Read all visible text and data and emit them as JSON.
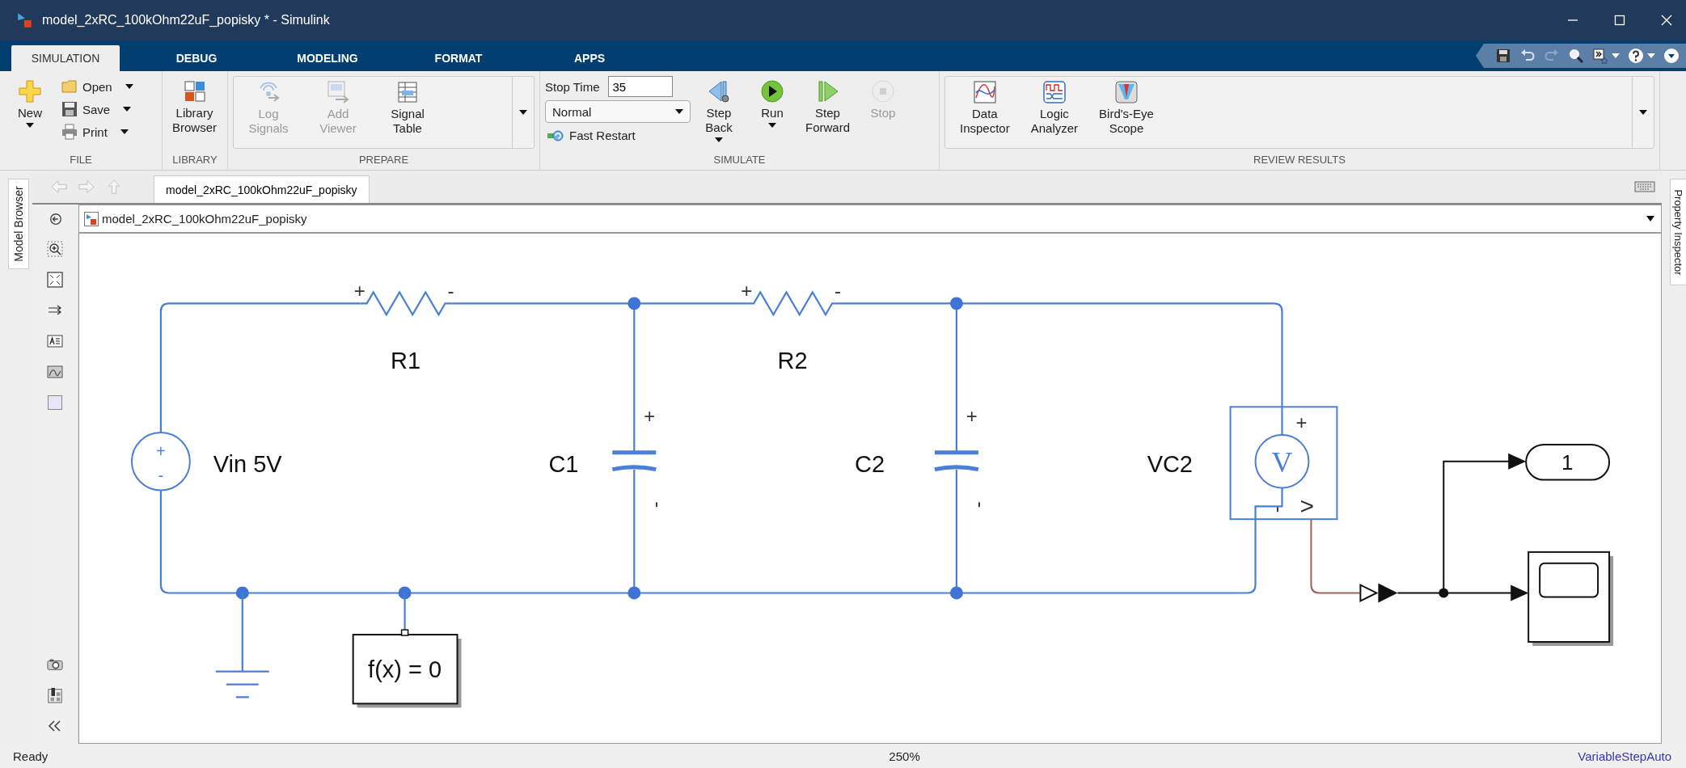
{
  "window": {
    "title": "model_2xRC_100kOhm22uF_popisky * - Simulink"
  },
  "tabs": [
    {
      "label": "SIMULATION",
      "selected": true
    },
    {
      "label": "DEBUG",
      "selected": false
    },
    {
      "label": "MODELING",
      "selected": false
    },
    {
      "label": "FORMAT",
      "selected": false
    },
    {
      "label": "APPS",
      "selected": false
    }
  ],
  "ribbon": {
    "file": {
      "title": "FILE",
      "new": "New",
      "open": "Open",
      "save": "Save",
      "print": "Print"
    },
    "library": {
      "title": "LIBRARY",
      "browser": "Library\nBrowser"
    },
    "prepare": {
      "title": "PREPARE",
      "buttons": [
        {
          "label": "Log\nSignals",
          "disabled": true
        },
        {
          "label": "Add\nViewer",
          "disabled": true
        },
        {
          "label": "Signal\nTable",
          "disabled": false
        }
      ]
    },
    "simulate": {
      "title": "SIMULATE",
      "stop_time_label": "Stop Time",
      "stop_time": "35",
      "mode": "Normal",
      "fast_restart": "Fast Restart",
      "buttons": [
        {
          "label": "Step\nBack",
          "disabled": false
        },
        {
          "label": "Run",
          "disabled": false
        },
        {
          "label": "Step\nForward",
          "disabled": false
        },
        {
          "label": "Stop",
          "disabled": true
        }
      ]
    },
    "review": {
      "title": "REVIEW RESULTS",
      "buttons": [
        {
          "label": "Data\nInspector"
        },
        {
          "label": "Logic\nAnalyzer"
        },
        {
          "label": "Bird's-Eye\nScope"
        }
      ]
    }
  },
  "editor": {
    "tab": "model_2xRC_100kOhm22uF_popisky",
    "address": "model_2xRC_100kOhm22uF_popisky",
    "model_browser": "Model Browser",
    "property_inspector": "Property Inspector"
  },
  "diagram": {
    "source": {
      "name": "Vin 5V",
      "plus": "+",
      "minus": "-"
    },
    "resistors": [
      {
        "name": "R1",
        "plus": "+",
        "minus": "-"
      },
      {
        "name": "R2",
        "plus": "+",
        "minus": "-"
      }
    ],
    "capacitors": [
      {
        "name": "C1",
        "plus": "+",
        "minus": "-"
      },
      {
        "name": "C2",
        "plus": "+",
        "minus": "-"
      }
    ],
    "sensor": {
      "name": "VC2",
      "symbol": "V",
      "plus": "+",
      "minus": "-",
      "output": ">"
    },
    "solver": {
      "label": "f(x) = 0"
    },
    "outport": {
      "label": "1"
    }
  },
  "status_bar": {
    "state": "Ready",
    "zoom": "250%",
    "solver": "VariableStepAuto"
  }
}
